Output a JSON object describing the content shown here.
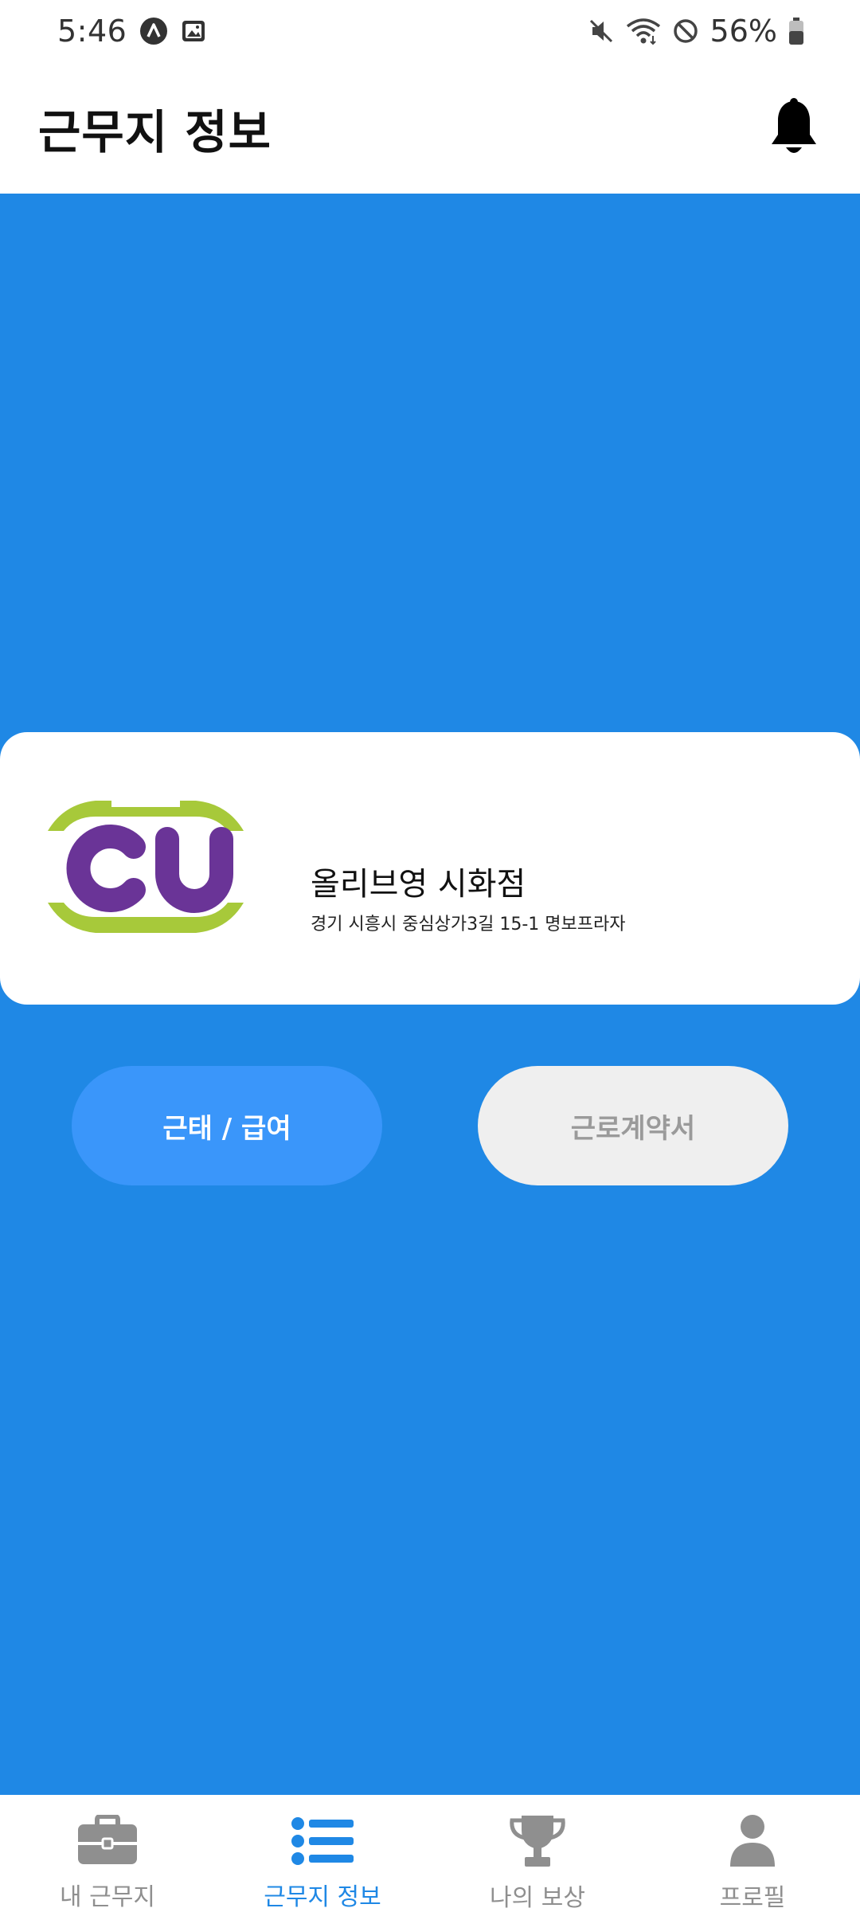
{
  "status_bar": {
    "time": "5:46",
    "battery": "56%",
    "icons": [
      "app-a-icon",
      "gallery-icon",
      "mute-icon",
      "wifi-icon",
      "dnd-icon",
      "battery-icon"
    ]
  },
  "header": {
    "title": "근무지 정보",
    "bell_icon": "bell-icon"
  },
  "colors": {
    "content_bg": "#1f88e5",
    "primary_button": "#3a96fa",
    "disabled_button": "#efefef",
    "nav_active": "#1f88e5",
    "nav_inactive": "#8f8f8f",
    "logo_purple": "#6a3497",
    "logo_green": "#a7c93a"
  },
  "workplace": {
    "logo_text": "CU",
    "name": "올리브영 시화점",
    "address": "경기 시흥시 중심상가3길 15-1 명보프라자",
    "buttons": {
      "attendance": "근태 / 급여",
      "contract": "근로계약서"
    }
  },
  "bottom_nav": {
    "items": [
      {
        "label": "내 근무지",
        "icon": "briefcase-icon",
        "active": false
      },
      {
        "label": "근무지 정보",
        "icon": "list-icon",
        "active": true
      },
      {
        "label": "나의 보상",
        "icon": "trophy-icon",
        "active": false
      },
      {
        "label": "프로필",
        "icon": "user-icon",
        "active": false
      }
    ]
  }
}
